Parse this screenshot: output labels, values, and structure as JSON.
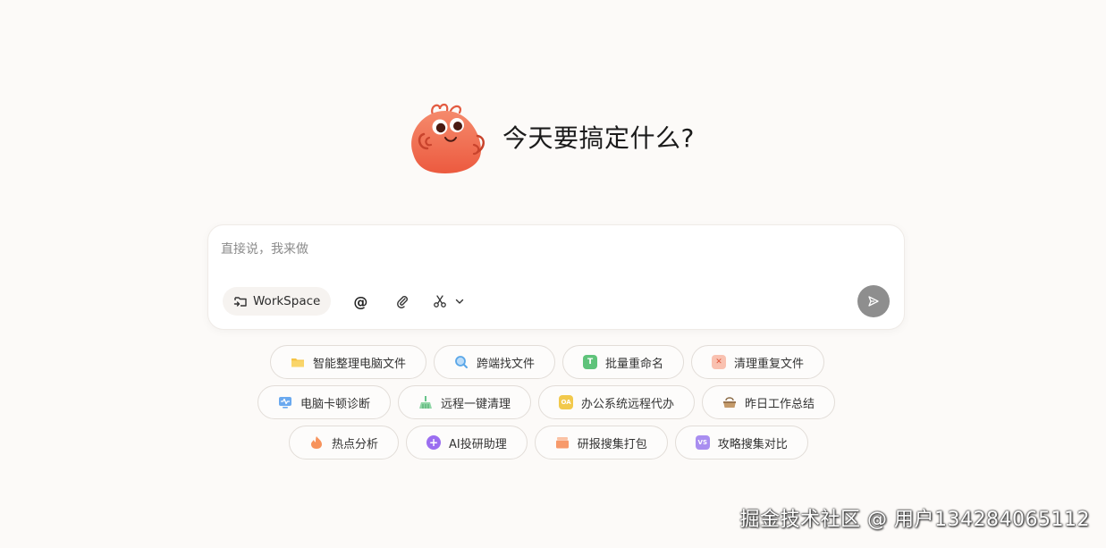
{
  "hero": {
    "title": "今天要搞定什么?"
  },
  "input": {
    "placeholder": "直接说，我来做",
    "value": ""
  },
  "toolbar": {
    "workspace_label": "WorkSpace",
    "at_symbol": "@"
  },
  "chips": {
    "row1": [
      {
        "label": "智能整理电脑文件",
        "icon": "folder-icon",
        "color": "#f6c445"
      },
      {
        "label": "跨端找文件",
        "icon": "magnifier-icon",
        "color": "#5aa7e8"
      },
      {
        "label": "批量重命名",
        "icon": "t-letter-icon",
        "color": "#5fc37a",
        "glyph": "T"
      },
      {
        "label": "清理重复文件",
        "icon": "delete-box-icon",
        "color": "#f39a7e",
        "glyph": "✕"
      }
    ],
    "row2": [
      {
        "label": "电脑卡顿诊断",
        "icon": "monitor-pulse-icon",
        "color": "#6aa9ef"
      },
      {
        "label": "远程一键清理",
        "icon": "broom-icon",
        "color": "#68c48a"
      },
      {
        "label": "办公系统远程代办",
        "icon": "oa-icon",
        "color": "#f2c94c",
        "glyph": "OA"
      },
      {
        "label": "昨日工作总结",
        "icon": "basket-icon",
        "color": "#b58a5a"
      }
    ],
    "row3": [
      {
        "label": "热点分析",
        "icon": "flame-icon",
        "color": "#f7935c"
      },
      {
        "label": "AI投研助理",
        "icon": "ai-plus-icon",
        "color": "#9b6ef0",
        "glyph": "+"
      },
      {
        "label": "研报搜集打包",
        "icon": "stack-icon",
        "color": "#f79a6b"
      },
      {
        "label": "攻略搜集对比",
        "icon": "vs-icon",
        "color": "#a98ef0",
        "glyph": "VS"
      }
    ]
  },
  "watermark": "掘金技术社区 @ 用户134284065112",
  "colors": {
    "background": "#fcfaf8",
    "send_button": "#8e8e8e",
    "mascot_body": "#f0664a"
  }
}
